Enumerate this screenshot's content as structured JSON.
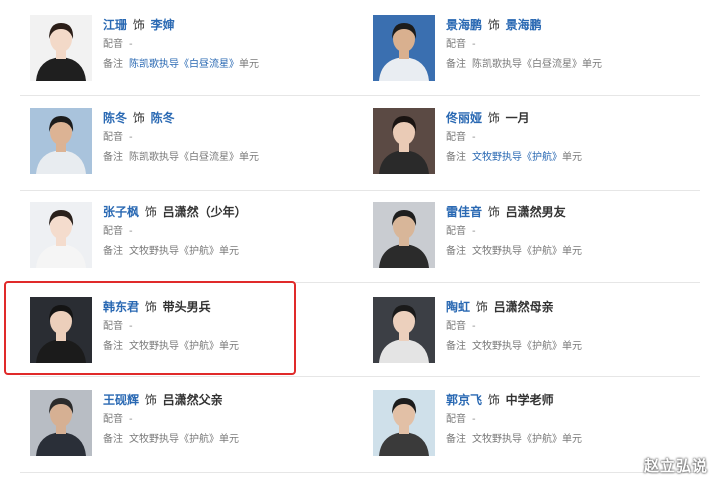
{
  "cast": [
    {
      "actor": "江珊",
      "shi": "饰",
      "role": "李婶",
      "role_link": true,
      "dub_label": "配音",
      "dub": "-",
      "note_label": "备注",
      "note_before": "",
      "note_link": "陈凯歌执导《白昼流星》",
      "note_after": "单元",
      "photo": {
        "bg": "#f2f2f2",
        "hair": "#2b1e18",
        "skin": "#f3d9c8",
        "cloth": "#1f1f1f"
      }
    },
    {
      "actor": "景海鹏",
      "shi": "饰",
      "role": "景海鹏",
      "role_link": true,
      "dub_label": "配音",
      "dub": "-",
      "note_label": "备注",
      "note_before": "陈凯歌执导《白昼流星》单元",
      "note_link": "",
      "note_after": "",
      "photo": {
        "bg": "#3a6fb0",
        "hair": "#1c1c1c",
        "skin": "#d9b08f",
        "cloth": "#e9edf2"
      }
    },
    {
      "actor": "陈冬",
      "shi": "饰",
      "role": "陈冬",
      "role_link": true,
      "dub_label": "配音",
      "dub": "-",
      "note_label": "备注",
      "note_before": "陈凯歌执导《白昼流星》单元",
      "note_link": "",
      "note_after": "",
      "photo": {
        "bg": "#a9c3dc",
        "hair": "#1c1c1c",
        "skin": "#dcb394",
        "cloth": "#e8ecf0"
      }
    },
    {
      "actor": "佟丽娅",
      "shi": "饰",
      "role": "一月",
      "role_link": false,
      "dub_label": "配音",
      "dub": "-",
      "note_label": "备注",
      "note_before": "",
      "note_link": "文牧野执导《护航》",
      "note_after": "单元",
      "photo": {
        "bg": "#5b4a44",
        "hair": "#1a1412",
        "skin": "#eacbb6",
        "cloth": "#2a2a2a"
      }
    },
    {
      "actor": "张子枫",
      "shi": "饰",
      "role": "吕潇然（少年）",
      "role_link": false,
      "dub_label": "配音",
      "dub": "-",
      "note_label": "备注",
      "note_before": "文牧野执导《护航》单元",
      "note_link": "",
      "note_after": "",
      "photo": {
        "bg": "#eef0f3",
        "hair": "#2a211c",
        "skin": "#f4dccd",
        "cloth": "#f5f5f5"
      }
    },
    {
      "actor": "雷佳音",
      "shi": "饰",
      "role": "吕潇然男友",
      "role_link": false,
      "dub_label": "配音",
      "dub": "-",
      "note_label": "备注",
      "note_before": "文牧野执导《护航》单元",
      "note_link": "",
      "note_after": "",
      "photo": {
        "bg": "#c9ccd1",
        "hair": "#1e1e1e",
        "skin": "#d8b699",
        "cloth": "#2b2b2b"
      }
    },
    {
      "actor": "韩东君",
      "shi": "饰",
      "role": "带头男兵",
      "role_link": false,
      "dub_label": "配音",
      "dub": "-",
      "note_label": "备注",
      "note_before": "文牧野执导《护航》单元",
      "note_link": "",
      "note_after": "",
      "photo": {
        "bg": "#2a2d33",
        "hair": "#141414",
        "skin": "#eccfbb",
        "cloth": "#1b1b1b"
      }
    },
    {
      "actor": "陶虹",
      "shi": "饰",
      "role": "吕潇然母亲",
      "role_link": false,
      "dub_label": "配音",
      "dub": "-",
      "note_label": "备注",
      "note_before": "文牧野执导《护航》单元",
      "note_link": "",
      "note_after": "",
      "photo": {
        "bg": "#3c3f45",
        "hair": "#1a1a1a",
        "skin": "#ecd0bd",
        "cloth": "#e4e4e4"
      }
    },
    {
      "actor": "王砚辉",
      "shi": "饰",
      "role": "吕潇然父亲",
      "role_link": false,
      "dub_label": "配音",
      "dub": "-",
      "note_label": "备注",
      "note_before": "文牧野执导《护航》单元",
      "note_link": "",
      "note_after": "",
      "photo": {
        "bg": "#b8bdc4",
        "hair": "#2b2b2b",
        "skin": "#d6b093",
        "cloth": "#2a2f38"
      }
    },
    {
      "actor": "郭京飞",
      "shi": "饰",
      "role": "中学老师",
      "role_link": false,
      "dub_label": "配音",
      "dub": "-",
      "note_label": "备注",
      "note_before": "文牧野执导《护航》单元",
      "note_link": "",
      "note_after": "",
      "photo": {
        "bg": "#cfe0ea",
        "hair": "#1c1c1c",
        "skin": "#e2c0a6",
        "cloth": "#3a3a3a"
      }
    }
  ],
  "watermark": "赵立弘说"
}
